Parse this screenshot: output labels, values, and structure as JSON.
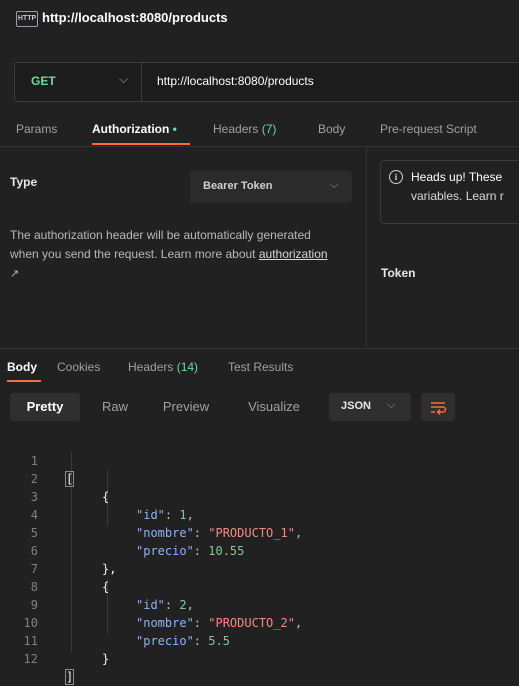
{
  "titlebar": {
    "icon_label": "HTTP",
    "title": "http://localhost:8080/products"
  },
  "request": {
    "method": "GET",
    "url": "http://localhost:8080/products"
  },
  "request_tabs": [
    {
      "label": "Params"
    },
    {
      "label": "Authorization",
      "indicator": "•"
    },
    {
      "label": "Headers",
      "count": "(7)"
    },
    {
      "label": "Body"
    },
    {
      "label": "Pre-request Script"
    }
  ],
  "auth": {
    "type_label": "Type",
    "type_value": "Bearer Token",
    "description": "The authorization header will be automatically generated when you send the request. Learn more about ",
    "link": "authorization",
    "link_arrow": "↗",
    "notice_line1": "Heads up! These",
    "notice_line2": "variables. Learn r",
    "token_label": "Token"
  },
  "response_tabs": [
    {
      "label": "Body"
    },
    {
      "label": "Cookies"
    },
    {
      "label": "Headers",
      "count": "(14)"
    },
    {
      "label": "Test Results"
    }
  ],
  "view_tabs": [
    "Pretty",
    "Raw",
    "Preview",
    "Visualize"
  ],
  "format": "JSON",
  "code_lines": [
    {
      "n": "1"
    },
    {
      "n": "2"
    },
    {
      "n": "3"
    },
    {
      "n": "4"
    },
    {
      "n": "5"
    },
    {
      "n": "6"
    },
    {
      "n": "7"
    },
    {
      "n": "8"
    },
    {
      "n": "9"
    },
    {
      "n": "10"
    },
    {
      "n": "11"
    },
    {
      "n": "12"
    }
  ],
  "json": {
    "open_array": "[",
    "close_array": "]",
    "open_obj": "{",
    "close_obj_comma": "},",
    "close_obj": "}",
    "key_id": "\"id\"",
    "key_nombre": "\"nombre\"",
    "key_precio": "\"precio\"",
    "colon": ": ",
    "comma": ",",
    "items": [
      {
        "id": "1",
        "nombre": "\"PRODUCTO_1\"",
        "precio": "10.55"
      },
      {
        "id": "2",
        "nombre": "\"PRODUCTO_2\"",
        "precio": "5.5"
      }
    ]
  },
  "colors": {
    "accent": "#ff6c37",
    "method": "#6bdd9a",
    "key": "#8ab4f8",
    "string": "#f28b82",
    "number": "#81c995"
  }
}
